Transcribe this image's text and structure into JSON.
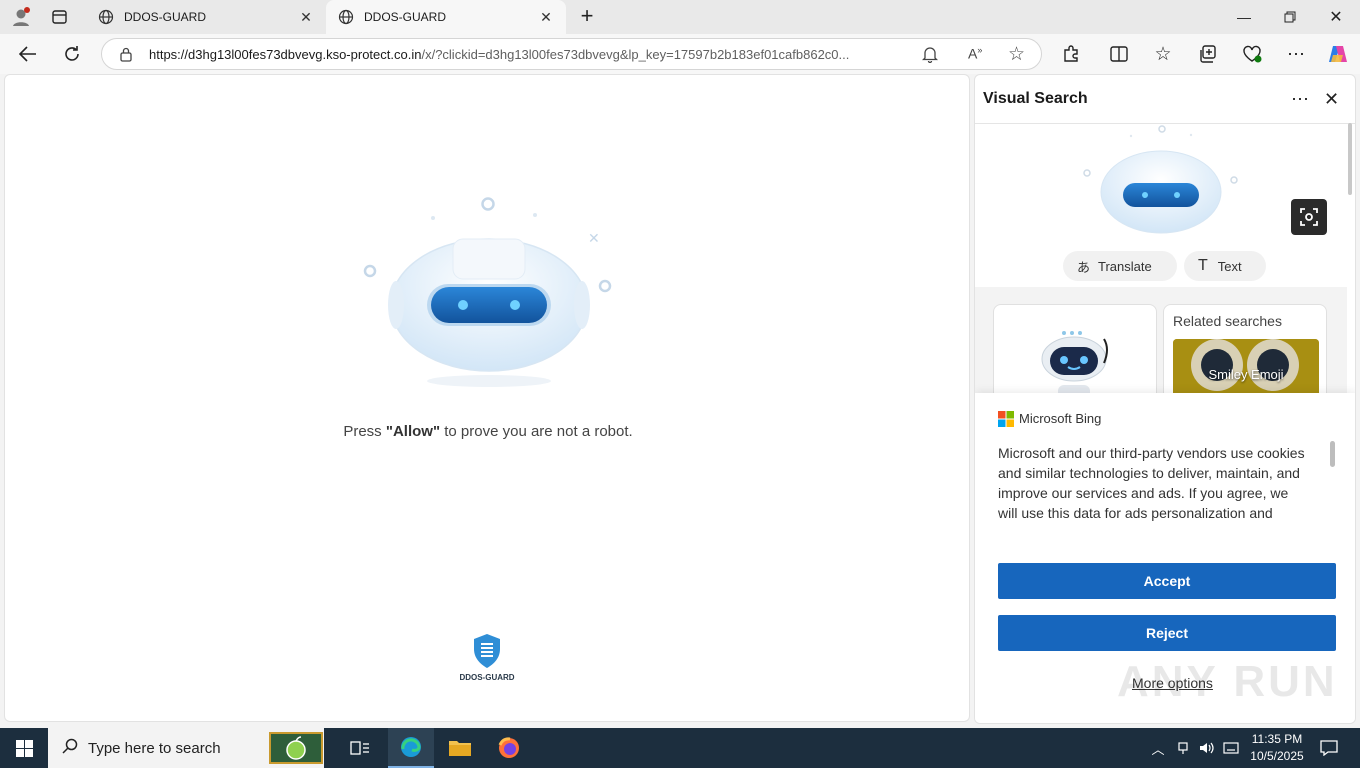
{
  "browser": {
    "tabs": [
      {
        "title": "DDOS-GUARD",
        "active": false
      },
      {
        "title": "DDOS-GUARD",
        "active": true
      }
    ],
    "url_host": "https://d3hg13l00fes73dbvevg.kso-protect.co.in",
    "url_rest": "/x/?clickid=d3hg13l00fes73dbvevg&lp_key=17597b2b183ef01cafb862c0..."
  },
  "page": {
    "prompt_before": "Press ",
    "prompt_strong": "\"Allow\"",
    "prompt_after": " to prove you are not a robot.",
    "logo_text": "DDOS-GUARD"
  },
  "visual_search": {
    "title": "Visual Search",
    "translate_label": "Translate",
    "text_label": "Text",
    "related_heading": "Related searches",
    "related_item": "Smiley Emoji"
  },
  "consent": {
    "brand": "Microsoft Bing",
    "text": "Microsoft and our third-party vendors use cookies and similar technologies to deliver, maintain, and improve our services and ads. If you agree, we will use this data for ads personalization and",
    "accept_label": "Accept",
    "reject_label": "Reject",
    "more_label": "More options"
  },
  "watermark": "ANY RUN",
  "taskbar": {
    "search_placeholder": "Type here to search",
    "time": "11:35 PM",
    "date": "10/5/2025"
  },
  "colors": {
    "accent": "#1766bd",
    "taskbar": "#1c2e3e",
    "robot_visor": "#1e6fc0"
  },
  "icons": [
    "profile-icon",
    "tab-actions-icon",
    "globe-icon",
    "close-icon",
    "new-tab-icon",
    "minimize-icon",
    "restore-icon",
    "back-icon",
    "refresh-icon",
    "lock-icon",
    "bell-icon",
    "read-aloud-icon",
    "favorite-icon",
    "extensions-icon",
    "split-screen-icon",
    "favorites-icon",
    "collections-icon",
    "browser-essentials-icon",
    "more-icon",
    "copilot-icon",
    "visual-search-icon",
    "translate-icon",
    "text-icon",
    "windows-start-icon",
    "search-icon",
    "task-view-icon",
    "edge-icon",
    "file-explorer-icon",
    "firefox-icon",
    "notification-icon"
  ]
}
